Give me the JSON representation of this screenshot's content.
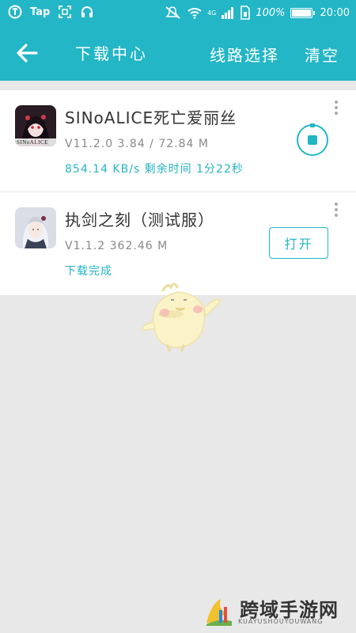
{
  "status_bar": {
    "app_label": "Tap",
    "battery_percent_label": "100%",
    "battery_level": 1.0,
    "time": "20:00",
    "network_label": "4G"
  },
  "header": {
    "title": "下载中心",
    "route_select_label": "线路选择",
    "clear_label": "清空"
  },
  "downloads": [
    {
      "name": "SINoALICE死亡爱丽丝",
      "meta": "V11.2.0 3.84 / 72.84 M",
      "status": "854.14 KB/s  剩余时间 1分22秒",
      "thumb_text": "SINoALICE",
      "action": "stop"
    },
    {
      "name": "执剑之刻（测试服）",
      "meta": "V1.1.2 362.46 M",
      "status": "下载完成",
      "action": "open",
      "action_label": "打开"
    }
  ],
  "watermark": {
    "brand": "跨域手游网",
    "sub": "KUAYUSHOUYOUWANG"
  },
  "colors": {
    "accent": "#23b6c6",
    "status_text": "#26b4c4",
    "background": "#e8e8e8"
  }
}
